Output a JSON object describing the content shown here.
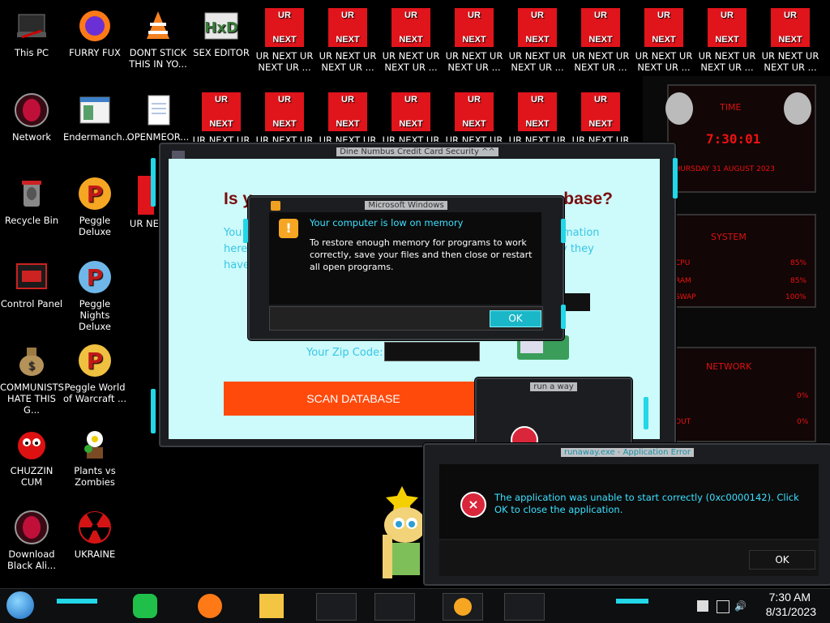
{
  "desktop": {
    "icons": [
      {
        "label": "This PC"
      },
      {
        "label": "FURRY FUX"
      },
      {
        "label": "DONT STICK THIS IN YO..."
      },
      {
        "label": "SEX EDITOR"
      },
      {
        "label": "Network"
      },
      {
        "label": "Endermanch..."
      },
      {
        "label": "OPENMEOR..."
      },
      {
        "label": "Recycle Bin"
      },
      {
        "label": "Peggle Deluxe"
      },
      {
        "label": "UR NE NEXT"
      },
      {
        "label": "Control Panel"
      },
      {
        "label": "Peggle Nights Deluxe"
      },
      {
        "label": "COMMUNISTS HATE THIS G..."
      },
      {
        "label": "Peggle World of Warcraft ..."
      },
      {
        "label": "CHUZZIN CUM"
      },
      {
        "label": "Plants vs Zombies"
      },
      {
        "label": "Download Black Ali..."
      },
      {
        "label": "UKRAINE"
      }
    ],
    "urnext_label": "UR NEXT UR NEXT UR ...",
    "urnext_label_short": "UR NEXT UR",
    "urnext_tile": {
      "top": "UR",
      "bottom": "NEXT"
    }
  },
  "card_window": {
    "title": "Dine Numbus Credit Card Security ^^",
    "heading": "Is y",
    "heading_end": "base?",
    "line1": "You",
    "line1_end": "mation",
    "line2": "here",
    "line2_end": "y they",
    "line3": "have",
    "zip_label": "Your Zip Code:",
    "scan_button": "SCAN DATABASE"
  },
  "memory_dialog": {
    "title": "Microsoft Windows",
    "heading": "Your computer is low on memory",
    "body": "To restore enough memory for programs to work correctly, save your files and then close or restart all open programs.",
    "ok": "OK"
  },
  "small_dialog": {
    "title": "run a way"
  },
  "error_dialog": {
    "title": "runaway.exe - Application Error",
    "message": "The application was unable to start correctly (0xc0000142). Click OK to close the application.",
    "ok": "OK"
  },
  "gadget": {
    "time_label": "TIME",
    "time": "7:30:01",
    "date": "THURSDAY 31 AUGUST 2023",
    "system_label": "SYSTEM",
    "cpu_label": "CPU",
    "cpu": "85%",
    "ram_label": "RAM",
    "ram": "85%",
    "swap_label": "SWAP",
    "swap": "100%",
    "network_label": "NETWORK",
    "net1": "0%",
    "net2_label": "OUT",
    "net2": "0%"
  },
  "taskbar": {
    "time": "7:30 AM",
    "date": "8/31/2023"
  },
  "colors": {
    "accent_cyan": "#21d7e8",
    "alert_red": "#e0141b",
    "scan_orange": "#ff4a0c"
  }
}
